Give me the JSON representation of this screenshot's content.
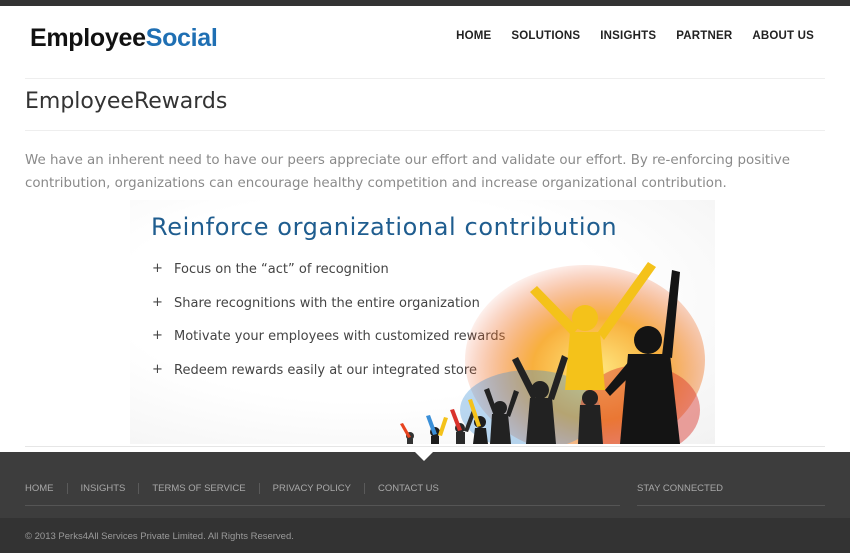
{
  "brand": {
    "logo_part1": "Employee",
    "logo_part2": "Social",
    "logo_color": "#1f6fb3"
  },
  "nav": {
    "items": [
      "HOME",
      "SOLUTIONS",
      "INSIGHTS",
      "PARTNER",
      "ABOUT US"
    ]
  },
  "page": {
    "title": "EmployeeRewards",
    "intro_line1": "We have an inherent need to have our peers appreciate our effort and validate our effort. By re-enforcing positive",
    "intro_line2": "contribution, organizations can encourage healthy competition and increase organizational contribution."
  },
  "banner": {
    "heading": "Reinforce organizational contribution",
    "bullet_symbol": "+",
    "bullets": [
      "Focus on the “act” of recognition",
      "Share recognitions with the entire organization",
      "Motivate your employees with customized rewards",
      "Redeem rewards easily at our integrated store"
    ],
    "heading_color": "#1f5d8f"
  },
  "footer": {
    "links": [
      "HOME",
      "INSIGHTS",
      "TERMS OF SERVICE",
      "PRIVACY POLICY",
      "CONTACT US"
    ],
    "stay_connected": "STAY CONNECTED",
    "copyright": "© 2013 Perks4All Services Private Limited. All Rights Reserved."
  }
}
